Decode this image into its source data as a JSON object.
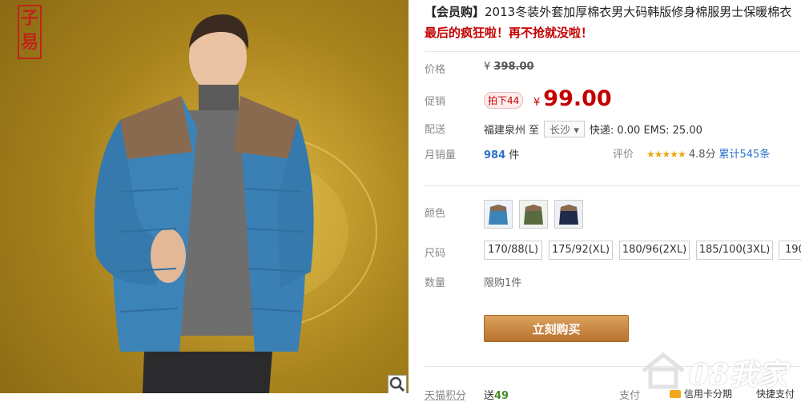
{
  "image": {
    "logo_chars": [
      "子",
      "易"
    ]
  },
  "product": {
    "title_tag": "【会员购】",
    "title": "2013冬装外套加厚棉衣男大码韩版修身棉服男士保暖棉衣",
    "promo": "最后的疯狂啦！再不抢就没啦！"
  },
  "price": {
    "label": "价格",
    "yen": "¥",
    "original": "398.00"
  },
  "promotion": {
    "label": "促销",
    "badge": "拍下44",
    "yen": "¥",
    "price": "99.00"
  },
  "delivery": {
    "label": "配送",
    "from": "福建泉州",
    "to_word": "至",
    "city": "长沙",
    "fees": "快递: 0.00 EMS: 25.00"
  },
  "sales": {
    "label": "月销量",
    "count": "984",
    "unit": "件"
  },
  "rating": {
    "label": "评价",
    "stars": "★★★★★",
    "score": "4.8分",
    "total": "累计545条"
  },
  "color": {
    "label": "颜色",
    "swatches": [
      "blue",
      "army-green",
      "navy"
    ]
  },
  "size": {
    "label": "尺码",
    "options": [
      "170/88(L)",
      "175/92(XL)",
      "180/96(2XL)",
      "185/100(3XL)",
      "190"
    ]
  },
  "quantity": {
    "label": "数量",
    "limit": "限购1件"
  },
  "buy_button": "立刻购买",
  "points": {
    "label": "天猫积分",
    "prefix": "送",
    "value": "49"
  },
  "payment": {
    "label": "支付",
    "option1": "信用卡分期",
    "option2": "快捷支付"
  },
  "watermark": "08我家",
  "colors": {
    "accent_red": "#c40000",
    "link_blue": "#2c71c9",
    "buy_orange": "#c98540"
  }
}
